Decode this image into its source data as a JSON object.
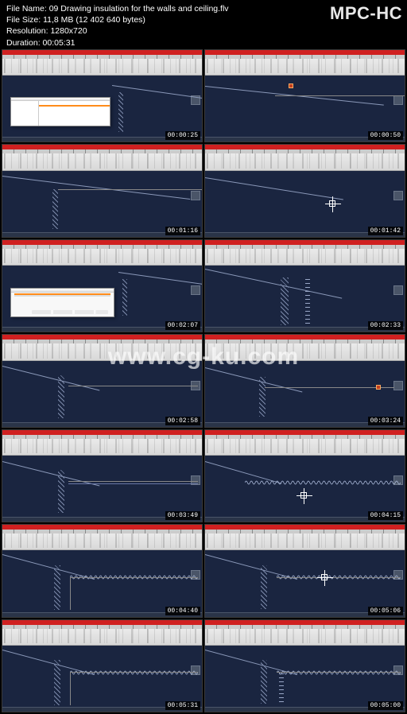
{
  "app": {
    "name": "MPC-HC"
  },
  "meta": {
    "filename_label": "File Name: ",
    "filename": "09 Drawing insulation for the walls and ceiling.flv",
    "filesize_label": "File Size: ",
    "filesize": "11,8 MB (12 402 640 bytes)",
    "resolution_label": "Resolution: ",
    "resolution": "1280x720",
    "duration_label": "Duration: ",
    "duration": "00:05:31"
  },
  "watermark": "www.cg-ku.com",
  "thumbs": [
    {
      "ts": "00:00:25",
      "variant": "dialog1"
    },
    {
      "ts": "00:00:50",
      "variant": "roof-top"
    },
    {
      "ts": "00:01:16",
      "variant": "roof-wall"
    },
    {
      "ts": "00:01:42",
      "variant": "roof-mid"
    },
    {
      "ts": "00:02:07",
      "variant": "dialog2"
    },
    {
      "ts": "00:02:33",
      "variant": "wall-hatch"
    },
    {
      "ts": "00:02:58",
      "variant": "roof-line1"
    },
    {
      "ts": "00:03:24",
      "variant": "roof-marker"
    },
    {
      "ts": "00:03:49",
      "variant": "roof-line2"
    },
    {
      "ts": "00:04:15",
      "variant": "ceiling-zig"
    },
    {
      "ts": "00:04:40",
      "variant": "corner-full"
    },
    {
      "ts": "00:05:06",
      "variant": "corner-cursor"
    },
    {
      "ts": "00:05:31",
      "variant": "corner-wide"
    },
    {
      "ts": "00:05:00",
      "variant": "corner-ins"
    }
  ]
}
